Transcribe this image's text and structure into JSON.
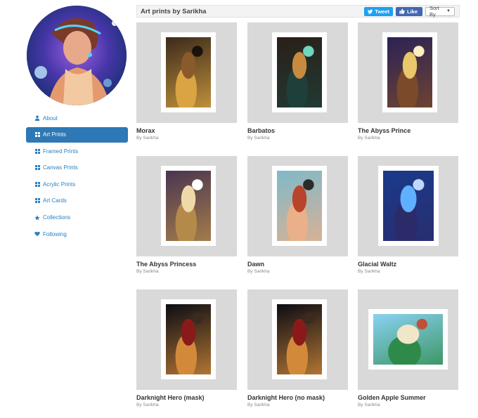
{
  "header": {
    "title": "Art prints by Sarikha",
    "tweet_label": "Tweet",
    "like_label": "Like",
    "sort_label": "Sort By"
  },
  "sidebar": {
    "items": [
      {
        "label": "About",
        "icon": "user-icon",
        "active": false
      },
      {
        "label": "Art Prints",
        "icon": "grid-icon",
        "active": true
      },
      {
        "label": "Framed Prints",
        "icon": "grid-icon",
        "active": false
      },
      {
        "label": "Canvas Prints",
        "icon": "grid-icon",
        "active": false
      },
      {
        "label": "Acrylic Prints",
        "icon": "grid-icon",
        "active": false
      },
      {
        "label": "Art Cards",
        "icon": "grid-icon",
        "active": false
      },
      {
        "label": "Collections",
        "icon": "star-icon",
        "active": false
      },
      {
        "label": "Following",
        "icon": "heart-icon",
        "active": false
      }
    ]
  },
  "artworks": [
    {
      "title": "Morax",
      "artist": "By Sarikha"
    },
    {
      "title": "Barbatos",
      "artist": "By Sarikha"
    },
    {
      "title": "The Abyss Prince",
      "artist": "By Sarikha"
    },
    {
      "title": "The Abyss Princess",
      "artist": "By Sarikha"
    },
    {
      "title": "Dawn",
      "artist": "By Sarikha"
    },
    {
      "title": "Glacial Waltz",
      "artist": "By Sarikha"
    },
    {
      "title": "Darknight Hero (mask)",
      "artist": "By Sarikha"
    },
    {
      "title": "Darknight Hero (no mask)",
      "artist": "By Sarikha"
    },
    {
      "title": "Golden Apple Summer",
      "artist": "By Sarikha"
    }
  ],
  "colors": {
    "accent": "#2d78b5",
    "link": "#2a7fc0",
    "tweet": "#1da1f2",
    "like": "#4267b2",
    "thumb_bg": "#d9d9d9"
  }
}
